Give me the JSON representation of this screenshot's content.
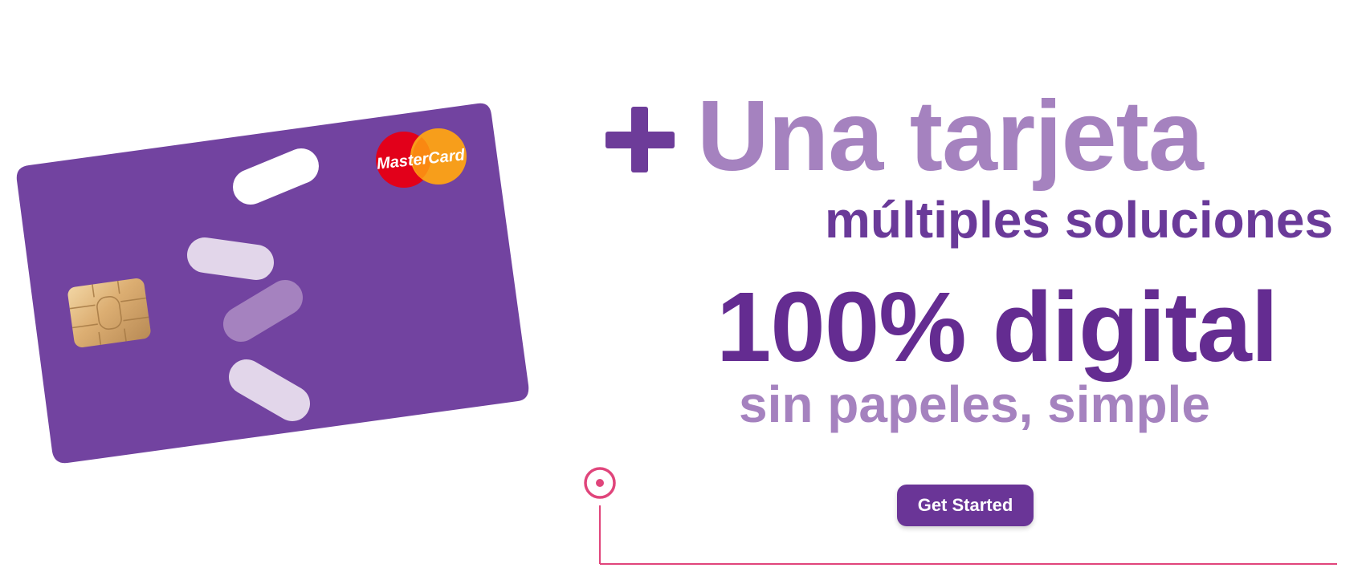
{
  "hero": {
    "plus_icon": "plus-icon",
    "headline": "Una tarjeta",
    "subheadline": "múltiples soluciones",
    "highlight": "100% digital",
    "tagline": "sin papeles, simple"
  },
  "card": {
    "brand_logo_text": "MasterCard",
    "card_color": "#7243a0",
    "icons": [
      "chip-icon",
      "mastercard-logo",
      "card-stripes-decoration"
    ]
  },
  "cta": {
    "label": "Get Started"
  },
  "colors": {
    "primary_purple": "#6a3597",
    "light_purple": "#a582bf",
    "accent_pink": "#e0457b"
  }
}
